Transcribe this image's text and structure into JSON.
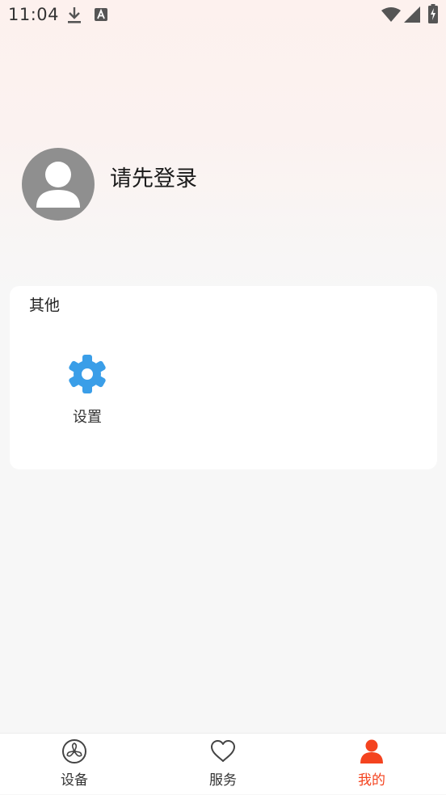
{
  "status_bar": {
    "time": "11:04",
    "icons": [
      "download-icon",
      "text-a-icon",
      "wifi-icon",
      "signal-icon",
      "battery-charging-icon"
    ]
  },
  "profile": {
    "login_prompt": "请先登录",
    "avatar_icon": "user-avatar-icon"
  },
  "other_section": {
    "title": "其他",
    "items": [
      {
        "label": "设置",
        "icon": "gear-icon",
        "color": "#3a9ee8"
      }
    ]
  },
  "bottom_nav": {
    "items": [
      {
        "label": "设备",
        "icon": "fan-icon",
        "active": false
      },
      {
        "label": "服务",
        "icon": "heart-icon",
        "active": false
      },
      {
        "label": "我的",
        "icon": "person-icon",
        "active": true
      }
    ]
  },
  "colors": {
    "accent": "#f4431f",
    "avatar": "#8f8f8f",
    "gear": "#3a9ee8"
  }
}
